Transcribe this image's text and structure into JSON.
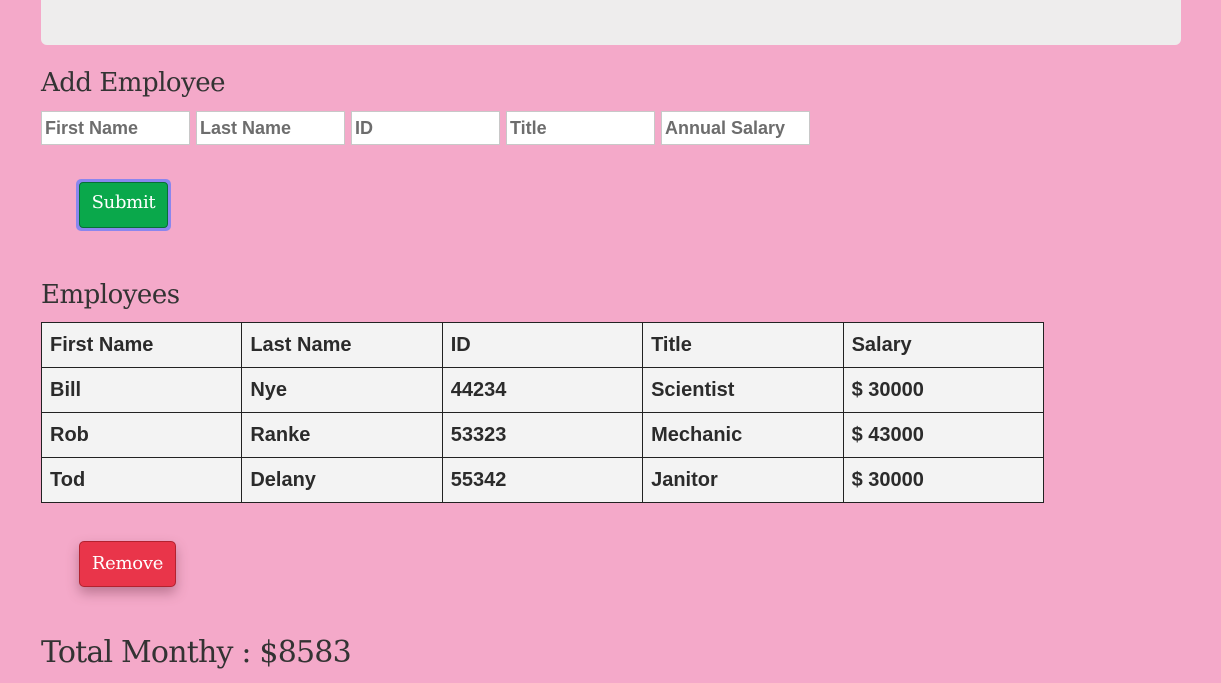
{
  "form": {
    "title": "Add Employee",
    "first_name_placeholder": "First Name",
    "last_name_placeholder": "Last Name",
    "id_placeholder": "ID",
    "title_placeholder": "Title",
    "salary_placeholder": "Annual Salary",
    "submit_label": "Submit"
  },
  "employees": {
    "title": "Employees",
    "headers": [
      "First Name",
      "Last Name",
      "ID",
      "Title",
      "Salary"
    ],
    "rows": [
      [
        "Bill",
        "Nye",
        "44234",
        "Scientist",
        "$ 30000"
      ],
      [
        "Rob",
        "Ranke",
        "53323",
        "Mechanic",
        "$ 43000"
      ],
      [
        "Tod",
        "Delany",
        "55342",
        "Janitor",
        "$ 30000"
      ]
    ],
    "remove_label": "Remove"
  },
  "total": {
    "label": "Total Monthy : $8583"
  },
  "colors": {
    "background": "#f4a9c9",
    "submit": "#0aa84b",
    "submit_focus_ring": "#8a86ee",
    "remove": "#e9354a",
    "table_bg": "#f3f3f3"
  }
}
